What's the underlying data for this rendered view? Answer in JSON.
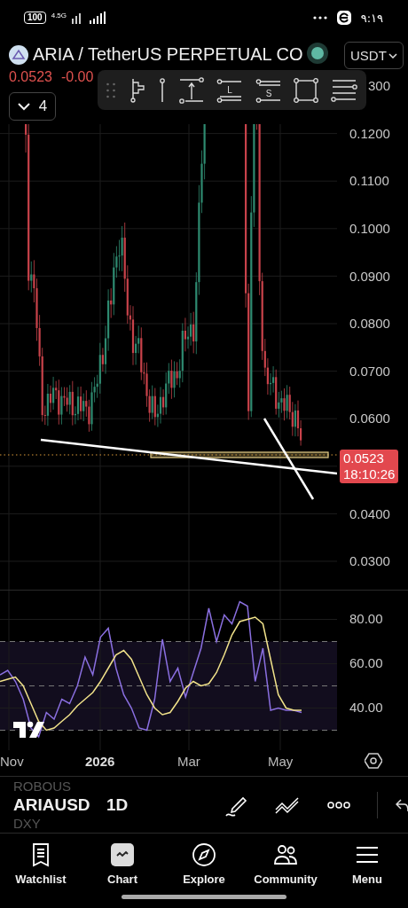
{
  "status_bar": {
    "battery": "100",
    "network": "4.5G",
    "time": "٩:١٩"
  },
  "header": {
    "title": "ARIA / TetherUS PERPETUAL CO",
    "price": "0.0523",
    "change": "-0.00",
    "indicator_count": "4",
    "currency": "USDT"
  },
  "drawing_toolbar": {
    "long_label": "L",
    "short_label": "S"
  },
  "price_axis": [
    "300",
    "0.1200",
    "0.1100",
    "0.1000",
    "0.0900",
    "0.0800",
    "0.0700",
    "0.0600",
    "0.0400",
    "0.0300"
  ],
  "price_tag": {
    "price": "0.0523",
    "countdown": "18:10:26"
  },
  "rsi_panel": {
    "chart_data": {
      "type": "line",
      "grid": true,
      "ylim": [
        21,
        93
      ],
      "yticks": [
        {
          "value": 80,
          "label": "80.00"
        },
        {
          "value": 60,
          "label": "60.00"
        },
        {
          "value": 40,
          "label": "40.00"
        }
      ],
      "series": [
        {
          "color": "#8a6fe0",
          "values": [
            55,
            57,
            52,
            44,
            31,
            27,
            38,
            35,
            44,
            42,
            50,
            63,
            55,
            72,
            76,
            58,
            46,
            40,
            31,
            30,
            44,
            71,
            52,
            58,
            45,
            56,
            67,
            85,
            70,
            82,
            78,
            88,
            86,
            52,
            67,
            39,
            40,
            39,
            39,
            38
          ]
        },
        {
          "color": "#f1e28a",
          "values": [
            52,
            53,
            54,
            50,
            42,
            34,
            30,
            31,
            34,
            37,
            41,
            44,
            47,
            52,
            58,
            64,
            66,
            62,
            54,
            46,
            40,
            37,
            38,
            43,
            49,
            52,
            50,
            51,
            56,
            64,
            73,
            79,
            80,
            81,
            78,
            62,
            46,
            40,
            39,
            39
          ]
        }
      ]
    }
  },
  "time_axis": [
    {
      "label": "Nov",
      "kind": "month"
    },
    {
      "label": "2026",
      "kind": "year"
    },
    {
      "label": "Mar",
      "kind": "month"
    },
    {
      "label": "May",
      "kind": "month"
    }
  ],
  "symbol_picker": [
    {
      "label": "ROBOUS",
      "selected": false
    },
    {
      "label": "ARIAUSD",
      "selected": true
    },
    {
      "label": "DXY",
      "selected": false
    }
  ],
  "interval": "1D",
  "nav": [
    {
      "label": "Watchlist",
      "kind": "watchlist",
      "selected": false
    },
    {
      "label": "Chart",
      "kind": "chart",
      "selected": true
    },
    {
      "label": "Explore",
      "kind": "explore",
      "selected": false
    },
    {
      "label": "Community",
      "kind": "community",
      "selected": false
    },
    {
      "label": "Menu",
      "kind": "menu",
      "selected": false
    }
  ]
}
